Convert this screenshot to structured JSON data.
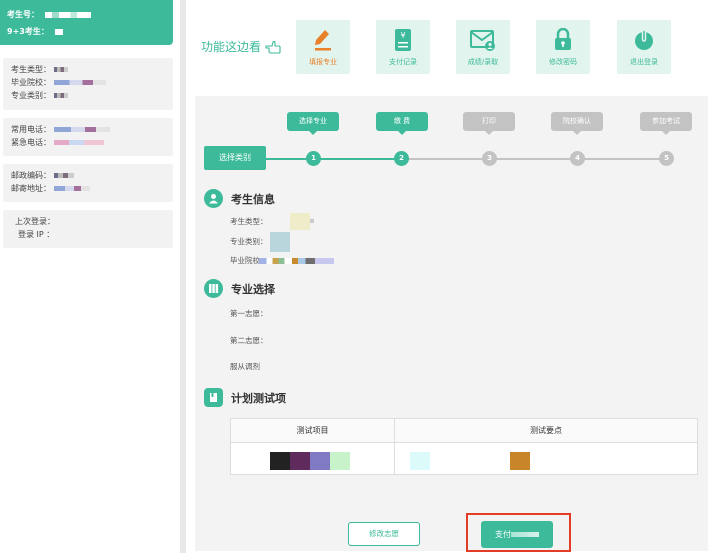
{
  "sidebar": {
    "exam_no_label": "考生号：",
    "code_label": "9+3考生：",
    "info_group_1": [
      {
        "label": "考生类型："
      },
      {
        "label": "毕业院校："
      },
      {
        "label": "专业类别："
      }
    ],
    "info_group_2": [
      {
        "label": "常用电话："
      },
      {
        "label": "紧急电话："
      }
    ],
    "info_group_3": [
      {
        "label": "邮政编码："
      },
      {
        "label": "邮寄地址："
      }
    ],
    "info_group_4": [
      {
        "label": "上次登录："
      },
      {
        "label": "登录 IP ："
      }
    ],
    "accent_color": "#3dba9a"
  },
  "toolbar": {
    "hint": "功能这边看",
    "buttons": [
      {
        "label": "填报专业",
        "icon": "pencil-icon",
        "active": true
      },
      {
        "label": "支付记录",
        "icon": "receipt-icon",
        "active": false
      },
      {
        "label": "成绩/录取",
        "icon": "mail-user-icon",
        "active": false
      },
      {
        "label": "修改密码",
        "icon": "lock-icon",
        "active": false
      },
      {
        "label": "退出登录",
        "icon": "power-icon",
        "active": false
      }
    ]
  },
  "steps": {
    "start": "选择类别",
    "items": [
      {
        "num": "1",
        "label": "选择专业",
        "state": "on"
      },
      {
        "num": "2",
        "label": "缴 费",
        "state": "on"
      },
      {
        "num": "3",
        "label": "打印",
        "state": "off"
      },
      {
        "num": "4",
        "label": "院校确认",
        "state": "off"
      },
      {
        "num": "5",
        "label": "参加考试",
        "state": "off"
      }
    ]
  },
  "student_info": {
    "title": "考生信息",
    "type_label": "考生类型：",
    "category_label": "专业类别：",
    "school_label": "毕业院校："
  },
  "major_select": {
    "title": "专业选择",
    "first_label": "第一志愿：",
    "second_label": "第二志愿：",
    "adjust_label": "服从调剂"
  },
  "tests": {
    "title": "计划测试项",
    "col_item": "测试项目",
    "col_points": "测试要点"
  },
  "actions": {
    "modify": "修改志愿",
    "pay": "支付"
  }
}
